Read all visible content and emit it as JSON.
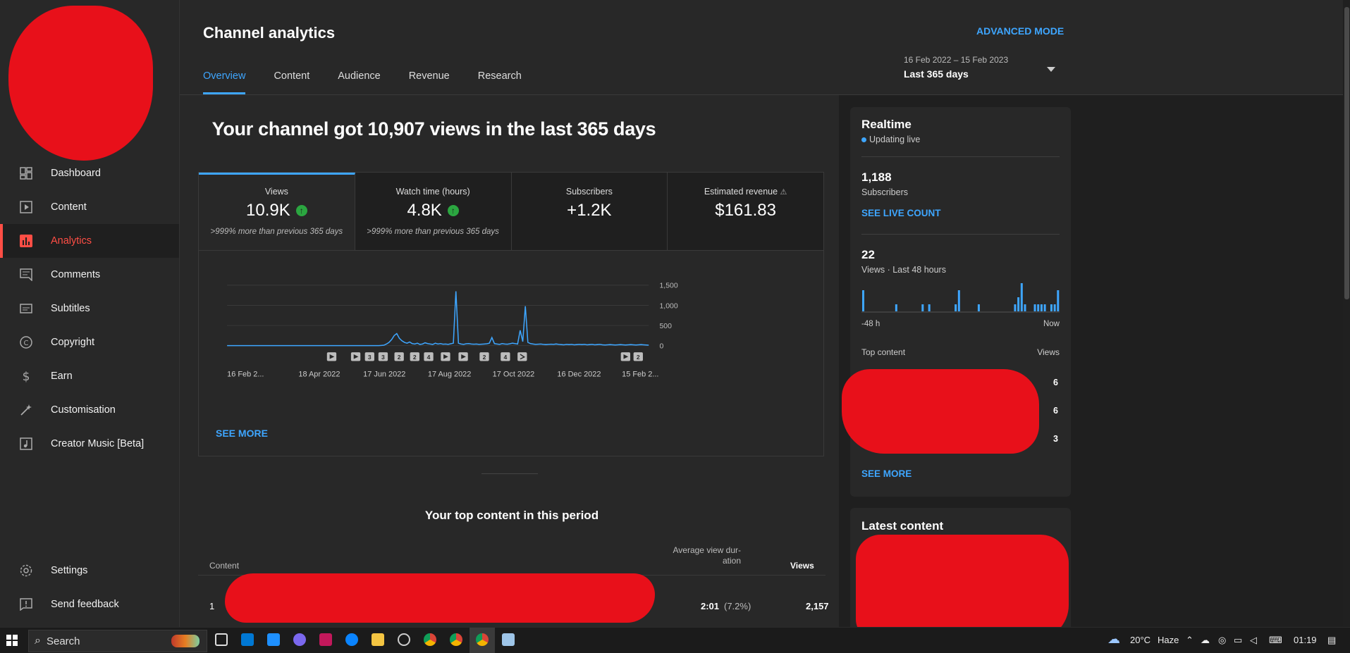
{
  "sidebar": {
    "items": [
      {
        "label": "Dashboard",
        "icon": "dashboard-icon"
      },
      {
        "label": "Content",
        "icon": "content-icon"
      },
      {
        "label": "Analytics",
        "icon": "analytics-icon"
      },
      {
        "label": "Comments",
        "icon": "comments-icon"
      },
      {
        "label": "Subtitles",
        "icon": "subtitles-icon"
      },
      {
        "label": "Copyright",
        "icon": "copyright-icon"
      },
      {
        "label": "Earn",
        "icon": "earn-icon"
      },
      {
        "label": "Customisation",
        "icon": "customisation-icon"
      },
      {
        "label": "Creator Music [Beta]",
        "icon": "creator-music-icon"
      }
    ],
    "bottom": [
      {
        "label": "Settings",
        "icon": "settings-icon"
      },
      {
        "label": "Send feedback",
        "icon": "feedback-icon"
      }
    ]
  },
  "header": {
    "title": "Channel analytics",
    "advanced_mode": "ADVANCED MODE",
    "tabs": [
      "Overview",
      "Content",
      "Audience",
      "Revenue",
      "Research"
    ],
    "date_sub": "16 Feb 2022 – 15 Feb 2023",
    "date_main": "Last 365 days"
  },
  "overview": {
    "headline": "Your channel got 10,907 views in the last 365 days",
    "metrics": [
      {
        "label": "Views",
        "value": "10.9K",
        "compare": ">999% more than previous 365 days"
      },
      {
        "label": "Watch time (hours)",
        "value": "4.8K",
        "compare": ">999% more than previous 365 days"
      },
      {
        "label": "Subscribers",
        "value": "+1.2K",
        "compare": ""
      },
      {
        "label": "Estimated revenue",
        "value": "$161.83",
        "compare": ""
      }
    ],
    "see_more": "SEE MORE",
    "top_content_title": "Your top content in this period",
    "table_headers": {
      "content": "Content",
      "avg_view_duration": "Average view dur-\nation",
      "views": "Views"
    },
    "table_rows": [
      {
        "rank": "1",
        "avg": "2:01",
        "pct": "(7.2%)",
        "views": "2,157"
      }
    ]
  },
  "chart_data": {
    "type": "line",
    "x_ticks": [
      "16 Feb 2...",
      "18 Apr 2022",
      "17 Jun 2022",
      "17 Aug 2022",
      "17 Oct 2022",
      "16 Dec 2022",
      "15 Feb 2..."
    ],
    "y_ticks": [
      "1,500",
      "1,000",
      "500",
      "0"
    ],
    "ylim": [
      0,
      1500
    ],
    "grid": true,
    "series": [
      {
        "values": [
          0,
          0,
          0,
          0,
          0,
          0,
          0,
          0,
          0,
          0,
          0,
          0,
          0,
          0,
          0,
          0,
          0,
          0,
          0,
          0,
          0,
          0,
          0,
          0,
          0,
          0,
          0,
          0,
          0,
          0,
          0,
          0,
          0,
          0,
          0,
          0,
          0,
          0,
          0,
          0,
          0,
          0,
          0,
          0,
          0,
          0,
          0,
          0,
          0,
          0,
          0,
          0,
          0,
          0,
          0,
          0,
          0,
          0,
          0,
          0,
          5,
          10,
          40,
          80,
          150,
          250,
          300,
          180,
          120,
          80,
          60,
          90,
          50,
          40,
          60,
          30,
          40,
          70,
          50,
          40,
          30,
          60,
          40,
          50,
          35,
          40,
          30,
          45,
          60,
          1350,
          60,
          40,
          30,
          45,
          50,
          40,
          35,
          40,
          30,
          35,
          40,
          45,
          60,
          200,
          50,
          40,
          30,
          50,
          40,
          35,
          45,
          60,
          50,
          40,
          380,
          100,
          980,
          80,
          50,
          40,
          30,
          35,
          40,
          30,
          25,
          30,
          35,
          30,
          40,
          30,
          25,
          20,
          30,
          25,
          30,
          20,
          25,
          30,
          25,
          30,
          20,
          25,
          30,
          20,
          25,
          30,
          20,
          15,
          20,
          25,
          20,
          15,
          20,
          25,
          20,
          15,
          20,
          25,
          20,
          15,
          20,
          25,
          20,
          15,
          10
        ]
      }
    ],
    "markers": [
      "play",
      "play",
      "3",
      "3",
      "2",
      "2",
      "4",
      "play",
      "play",
      "2",
      "4",
      "short",
      "play",
      "2"
    ]
  },
  "realtime": {
    "title": "Realtime",
    "status": "Updating live",
    "subs_value": "1,188",
    "subs_label": "Subscribers",
    "see_live": "SEE LIVE COUNT",
    "views_value": "22",
    "views_label": "Views · Last 48 hours",
    "axis_left": "-48 h",
    "axis_right": "Now",
    "bars": [
      3,
      0,
      0,
      0,
      0,
      0,
      0,
      0,
      0,
      0,
      1,
      0,
      0,
      0,
      0,
      0,
      0,
      0,
      1,
      0,
      1,
      0,
      0,
      0,
      0,
      0,
      0,
      0,
      1,
      3,
      0,
      0,
      0,
      0,
      0,
      1,
      0,
      0,
      0,
      0,
      0,
      0,
      0,
      0,
      0,
      0,
      1,
      2,
      4,
      1,
      0,
      0,
      1,
      1,
      1,
      1,
      0,
      1,
      1,
      3
    ],
    "top_content_label": "Top content",
    "top_views_label": "Views",
    "top_rows": [
      "6",
      "6",
      "3"
    ],
    "see_more": "SEE MORE",
    "accent": "#3ea6ff"
  },
  "latest": {
    "title": "Latest content"
  },
  "taskbar": {
    "search": "Search",
    "weather": "20°C",
    "weather_desc": "Haze",
    "time": "01:19"
  }
}
